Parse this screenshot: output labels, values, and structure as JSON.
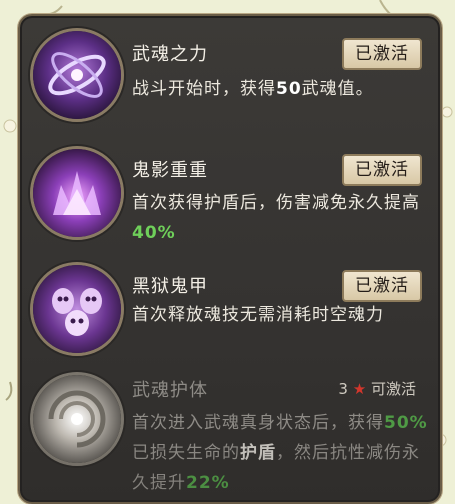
{
  "skills": [
    {
      "name": "武魂之力",
      "status": "已激活",
      "desc_parts": [
        "战斗开始时，获得",
        "50",
        "武魂值。"
      ],
      "icon": "ring-orb-icon"
    },
    {
      "name": "鬼影重重",
      "status": "已激活",
      "desc_parts": [
        "首次获得护盾后，伤害减免永久提高",
        "40%"
      ],
      "icon": "ghost-flame-icon"
    },
    {
      "name": "黑狱鬼甲",
      "status": "已激活",
      "desc_parts": [
        "首次释放魂技无需消耗时空魂力"
      ],
      "icon": "ghost-armor-icon"
    },
    {
      "name": "武魂护体",
      "requirement_count": "3",
      "requirement_label": "可激活",
      "desc_parts": [
        "首次进入武魂真身状态后，获得",
        "50%",
        "已损失生命的",
        "护盾",
        "，然后抗性减伤永久提升",
        "22%"
      ],
      "icon": "swirl-orb-icon"
    }
  ],
  "colors": {
    "panel": "#353331",
    "badge": "#e6d9bc",
    "highlight_green": "#6fd05a",
    "star_red": "#d2362c"
  }
}
